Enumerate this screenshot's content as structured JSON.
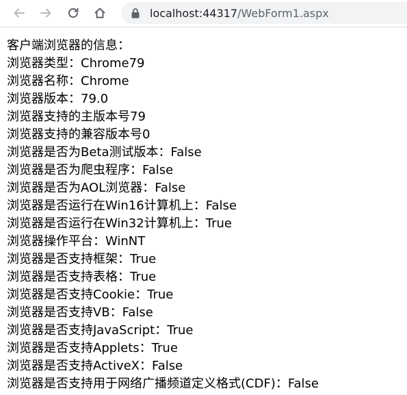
{
  "browser": {
    "url_host": "localhost:44317",
    "url_path": "/WebForm1.aspx"
  },
  "page": {
    "lines": [
      "客户端浏览器的信息：",
      "浏览器类型：Chrome79",
      "浏览器名称：Chrome",
      "浏览器版本：79.0",
      "浏览器支持的主版本号79",
      "浏览器支持的兼容版本号0",
      "浏览器是否为Beta测试版本：False",
      "浏览器是否为爬虫程序：False",
      "浏览器是否为AOL浏览器：False",
      "浏览器是否运行在Win16计算机上：False",
      "浏览器是否运行在Win32计算机上：True",
      "浏览器操作平台：WinNT",
      "浏览器是否支持框架：True",
      "浏览器是否支持表格：True",
      "浏览器是否支持Cookie：True",
      "浏览器是否支持VB：False",
      "浏览器是否支持JavaScript：True",
      "浏览器是否支持Applets：True",
      "浏览器是否支持ActiveX：False",
      "浏览器是否支持用于网络广播频道定义格式(CDF)：False"
    ]
  },
  "icons": {
    "back": "arrow-left-icon",
    "forward": "arrow-right-icon",
    "reload": "reload-icon",
    "home": "home-icon",
    "lock": "lock-icon"
  }
}
